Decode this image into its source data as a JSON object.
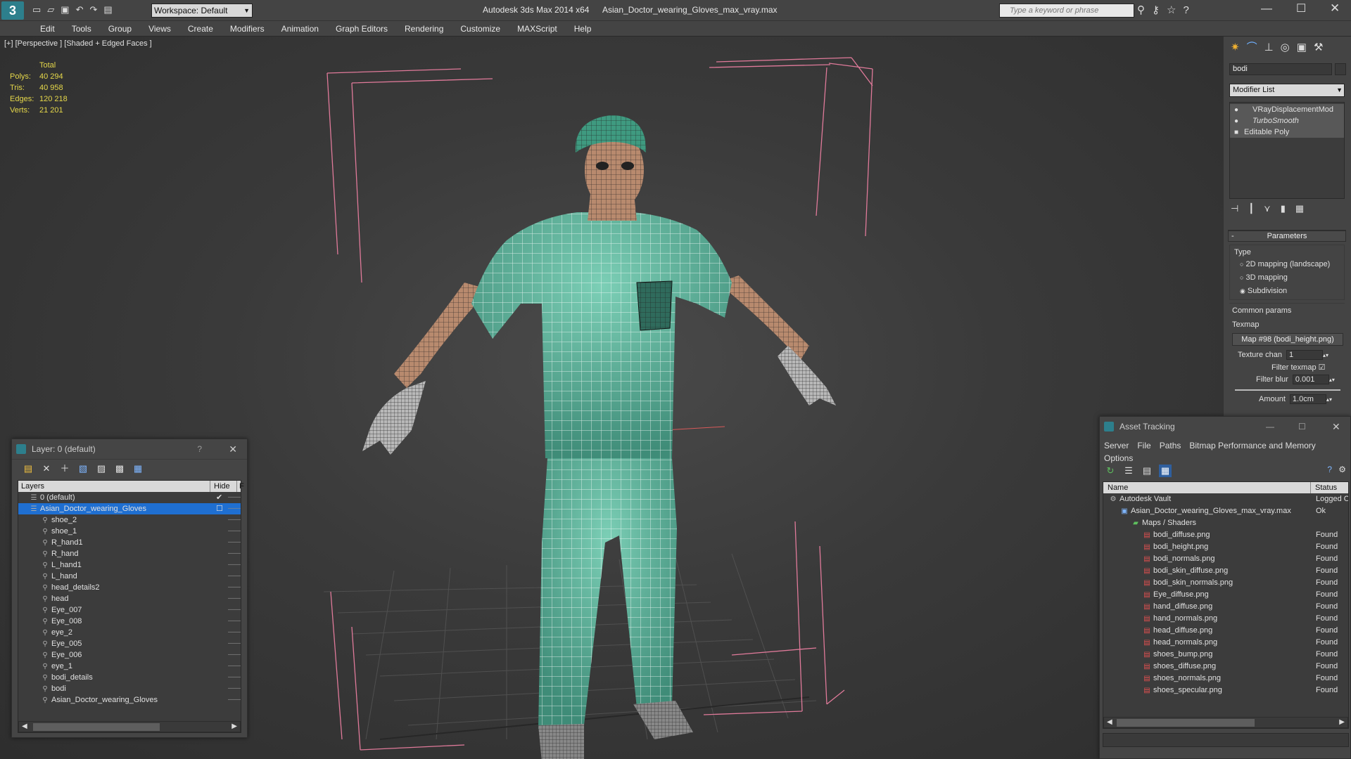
{
  "titlebar": {
    "workspace": "Workspace: Default",
    "app_title": "Autodesk 3ds Max  2014 x64",
    "file_title": "Asian_Doctor_wearing_Gloves_max_vray.max",
    "search_placeholder": "Type a keyword or phrase"
  },
  "menu": [
    "Edit",
    "Tools",
    "Group",
    "Views",
    "Create",
    "Modifiers",
    "Animation",
    "Graph Editors",
    "Rendering",
    "Customize",
    "MAXScript",
    "Help"
  ],
  "viewport": {
    "label": "[+] [Perspective ] [Shaded + Edged Faces ]",
    "stats": {
      "header": "Total",
      "rows": [
        {
          "label": "Polys:",
          "value": "40 294"
        },
        {
          "label": "Tris:",
          "value": "40 958"
        },
        {
          "label": "Edges:",
          "value": "120 218"
        },
        {
          "label": "Verts:",
          "value": "21 201"
        }
      ]
    }
  },
  "cmdpanel": {
    "object_name": "bodi",
    "modifier_list": "Modifier List",
    "stack": [
      "VRayDisplacementMod",
      "TurboSmooth",
      "Editable Poly"
    ],
    "parameters_title": "Parameters",
    "type_label": "Type",
    "type_options": [
      "2D mapping (landscape)",
      "3D mapping",
      "Subdivision"
    ],
    "common_label": "Common params",
    "texmap_label": "Texmap",
    "texmap_value": "Map #98 (bodi_height.png)",
    "texture_chan_label": "Texture chan",
    "texture_chan_value": "1",
    "filter_texmap_label": "Filter texmap",
    "filter_blur_label": "Filter blur",
    "filter_blur_value": "0.001",
    "amount_label": "Amount",
    "amount_value": "1.0cm"
  },
  "layers": {
    "title": "Layer: 0 (default)",
    "help": "?",
    "col_layers": "Layers",
    "col_hide": "Hide",
    "col_extra": "F",
    "items": [
      {
        "name": "0 (default)",
        "level": 0,
        "kind": "layer"
      },
      {
        "name": "Asian_Doctor_wearing_Gloves",
        "level": 0,
        "kind": "layer",
        "selected": true
      },
      {
        "name": "shoe_2",
        "level": 1,
        "kind": "obj"
      },
      {
        "name": "shoe_1",
        "level": 1,
        "kind": "obj"
      },
      {
        "name": "R_hand1",
        "level": 1,
        "kind": "obj"
      },
      {
        "name": "R_hand",
        "level": 1,
        "kind": "obj"
      },
      {
        "name": "L_hand1",
        "level": 1,
        "kind": "obj"
      },
      {
        "name": "L_hand",
        "level": 1,
        "kind": "obj"
      },
      {
        "name": "head_details2",
        "level": 1,
        "kind": "obj"
      },
      {
        "name": "head",
        "level": 1,
        "kind": "obj"
      },
      {
        "name": "Eye_007",
        "level": 1,
        "kind": "obj"
      },
      {
        "name": "Eye_008",
        "level": 1,
        "kind": "obj"
      },
      {
        "name": "eye_2",
        "level": 1,
        "kind": "obj"
      },
      {
        "name": "Eye_005",
        "level": 1,
        "kind": "obj"
      },
      {
        "name": "Eye_006",
        "level": 1,
        "kind": "obj"
      },
      {
        "name": "eye_1",
        "level": 1,
        "kind": "obj"
      },
      {
        "name": "bodi_details",
        "level": 1,
        "kind": "obj"
      },
      {
        "name": "bodi",
        "level": 1,
        "kind": "obj"
      },
      {
        "name": "Asian_Doctor_wearing_Gloves",
        "level": 1,
        "kind": "obj"
      }
    ]
  },
  "assets": {
    "title": "Asset Tracking",
    "menu": [
      "Server",
      "File",
      "Paths",
      "Bitmap Performance and Memory"
    ],
    "menu2": "Options",
    "col_name": "Name",
    "col_status": "Status",
    "rows": [
      {
        "name": "Autodesk Vault",
        "status": "Logged O",
        "level": 0,
        "kind": "vault"
      },
      {
        "name": "Asian_Doctor_wearing_Gloves_max_vray.max",
        "status": "Ok",
        "level": 1,
        "kind": "max"
      },
      {
        "name": "Maps / Shaders",
        "status": "",
        "level": 2,
        "kind": "folder"
      },
      {
        "name": "bodi_diffuse.png",
        "status": "Found",
        "level": 3,
        "kind": "png"
      },
      {
        "name": "bodi_height.png",
        "status": "Found",
        "level": 3,
        "kind": "png"
      },
      {
        "name": "bodi_normals.png",
        "status": "Found",
        "level": 3,
        "kind": "png"
      },
      {
        "name": "bodi_skin_diffuse.png",
        "status": "Found",
        "level": 3,
        "kind": "png"
      },
      {
        "name": "bodi_skin_normals.png",
        "status": "Found",
        "level": 3,
        "kind": "png"
      },
      {
        "name": "Eye_diffuse.png",
        "status": "Found",
        "level": 3,
        "kind": "png"
      },
      {
        "name": "hand_diffuse.png",
        "status": "Found",
        "level": 3,
        "kind": "png"
      },
      {
        "name": "hand_normals.png",
        "status": "Found",
        "level": 3,
        "kind": "png"
      },
      {
        "name": "head_diffuse.png",
        "status": "Found",
        "level": 3,
        "kind": "png"
      },
      {
        "name": "head_normals.png",
        "status": "Found",
        "level": 3,
        "kind": "png"
      },
      {
        "name": "shoes_bump.png",
        "status": "Found",
        "level": 3,
        "kind": "png"
      },
      {
        "name": "shoes_diffuse.png",
        "status": "Found",
        "level": 3,
        "kind": "png"
      },
      {
        "name": "shoes_normals.png",
        "status": "Found",
        "level": 3,
        "kind": "png"
      },
      {
        "name": "shoes_specular.png",
        "status": "Found",
        "level": 3,
        "kind": "png"
      }
    ]
  },
  "colors": {
    "selection": "#1f6fd1",
    "bbox": "#e07a9a",
    "mesh": "#5fae98",
    "skin": "#b88a6e"
  }
}
